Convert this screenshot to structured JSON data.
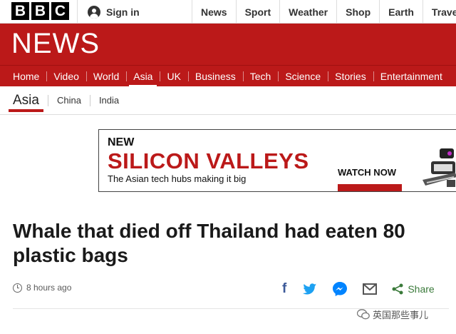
{
  "topbar": {
    "logo_letters": [
      "B",
      "B",
      "C"
    ],
    "signin_label": "Sign in",
    "signin_icon": "user-icon",
    "nav": [
      "News",
      "Sport",
      "Weather",
      "Shop",
      "Earth",
      "Travel"
    ]
  },
  "banner": {
    "title": "NEWS",
    "color": "#bb1919"
  },
  "section_nav": {
    "items": [
      "Home",
      "Video",
      "World",
      "Asia",
      "UK",
      "Business",
      "Tech",
      "Science",
      "Stories",
      "Entertainment"
    ],
    "active": "Asia"
  },
  "sub_nav": {
    "active": "Asia",
    "items": [
      "China",
      "India"
    ]
  },
  "ad": {
    "kicker": "NEW",
    "title": "SILICON VALLEYS",
    "subtitle": "The Asian tech hubs making it big",
    "cta": "WATCH NOW"
  },
  "article": {
    "headline": "Whale that died off Thailand had eaten 80 plastic bags",
    "timestamp": "8 hours ago",
    "share_label": "Share",
    "share_icons": [
      "facebook-icon",
      "twitter-icon",
      "messenger-icon",
      "email-icon",
      "share-icon"
    ]
  },
  "watermark": {
    "text": "英国那些事儿"
  }
}
